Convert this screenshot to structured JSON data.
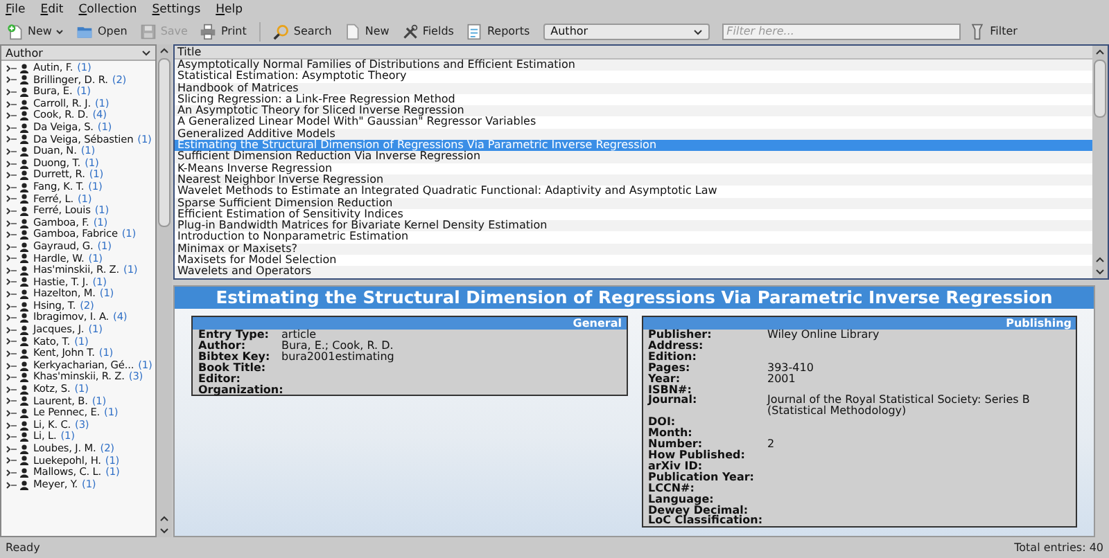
{
  "menu": [
    {
      "label": "File"
    },
    {
      "label": "Edit"
    },
    {
      "label": "Collection"
    },
    {
      "label": "Settings"
    },
    {
      "label": "Help"
    }
  ],
  "toolbar": {
    "buttons_left": [
      {
        "label": "New",
        "disabled": false,
        "has_menu": true
      },
      {
        "label": "Open",
        "disabled": false,
        "has_menu": false
      },
      {
        "label": "Save",
        "disabled": true,
        "has_menu": false
      },
      {
        "label": "Print",
        "disabled": false,
        "has_menu": false
      }
    ],
    "buttons_right": [
      {
        "label": "Search",
        "disabled": false,
        "has_menu": false
      },
      {
        "label": "New",
        "disabled": false,
        "has_menu": false
      },
      {
        "label": "Fields",
        "disabled": false,
        "has_menu": false
      },
      {
        "label": "Reports",
        "disabled": false,
        "has_menu": false
      }
    ],
    "field_selector": {
      "value": "Author"
    },
    "filter": {
      "placeholder": "Filter here..."
    },
    "filter_button": {
      "label": "Filter"
    }
  },
  "authors": {
    "header": "Author",
    "items": [
      {
        "name": "Autin, F.",
        "count": "(1)"
      },
      {
        "name": "Brillinger, D. R.",
        "count": "(2)"
      },
      {
        "name": "Bura, E.",
        "count": "(1)"
      },
      {
        "name": "Carroll, R. J.",
        "count": "(1)"
      },
      {
        "name": "Cook, R. D.",
        "count": "(4)"
      },
      {
        "name": "Da Veiga, S.",
        "count": "(1)"
      },
      {
        "name": "Da Veiga, Sébastien",
        "count": "(1)"
      },
      {
        "name": "Duan, N.",
        "count": "(1)"
      },
      {
        "name": "Duong, T.",
        "count": "(1)"
      },
      {
        "name": "Durrett, R.",
        "count": "(1)"
      },
      {
        "name": "Fang, K. T.",
        "count": "(1)"
      },
      {
        "name": "Ferré, L.",
        "count": "(1)"
      },
      {
        "name": "Ferré, Louis",
        "count": "(1)"
      },
      {
        "name": "Gamboa, F.",
        "count": "(1)"
      },
      {
        "name": "Gamboa, Fabrice",
        "count": "(1)"
      },
      {
        "name": "Gayraud, G.",
        "count": "(1)"
      },
      {
        "name": "Hardle, W.",
        "count": "(1)"
      },
      {
        "name": "Has'minskii, R. Z.",
        "count": "(1)"
      },
      {
        "name": "Hastie, T. J.",
        "count": "(1)"
      },
      {
        "name": "Hazelton, M.",
        "count": "(1)"
      },
      {
        "name": "Hsing, T.",
        "count": "(2)"
      },
      {
        "name": "Ibragimov, I. A.",
        "count": "(4)"
      },
      {
        "name": "Jacques, J.",
        "count": "(1)"
      },
      {
        "name": "Kato, T.",
        "count": "(1)"
      },
      {
        "name": "Kent, John T.",
        "count": "(1)"
      },
      {
        "name": "Kerkyacharian, Gé...",
        "count": "(1)"
      },
      {
        "name": "Khas'minskii, R. Z.",
        "count": "(3)"
      },
      {
        "name": "Kotz, S.",
        "count": "(1)"
      },
      {
        "name": "Laurent, B.",
        "count": "(1)"
      },
      {
        "name": "Le Pennec, E.",
        "count": "(1)"
      },
      {
        "name": "Li, K. C.",
        "count": "(3)"
      },
      {
        "name": "Li, L.",
        "count": "(1)"
      },
      {
        "name": "Loubes, J. M.",
        "count": "(2)"
      },
      {
        "name": "Luekepohl, H.",
        "count": "(1)"
      },
      {
        "name": "Mallows, C. L.",
        "count": "(1)"
      },
      {
        "name": "Meyer, Y.",
        "count": "(1)"
      }
    ]
  },
  "entries": {
    "header": "Title",
    "rows": [
      {
        "title": "Asymptotically Normal Families of Distributions and Efficient Estimation",
        "selected": false
      },
      {
        "title": "Statistical Estimation: Asymptotic Theory",
        "selected": false
      },
      {
        "title": "Handbook of Matrices",
        "selected": false
      },
      {
        "title": "Slicing Regression: a Link-Free Regression Method",
        "selected": false
      },
      {
        "title": "An Asymptotic Theory for Sliced Inverse Regression",
        "selected": false
      },
      {
        "title": "A Generalized Linear Model With\" Gaussian\" Regressor Variables",
        "selected": false
      },
      {
        "title": "Generalized Additive Models",
        "selected": false
      },
      {
        "title": "Estimating the Structural Dimension of Regressions Via Parametric Inverse Regression",
        "selected": true
      },
      {
        "title": "Sufficient Dimension Reduction Via Inverse Regression",
        "selected": false
      },
      {
        "title": "K-Means Inverse Regression",
        "selected": false
      },
      {
        "title": "Nearest Neighbor Inverse Regression",
        "selected": false
      },
      {
        "title": "Wavelet Methods to Estimate an Integrated Quadratic Functional: Adaptivity and Asymptotic Law",
        "selected": false
      },
      {
        "title": "Sparse Sufficient Dimension Reduction",
        "selected": false
      },
      {
        "title": "Efficient Estimation of Sensitivity Indices",
        "selected": false
      },
      {
        "title": "Plug-in Bandwidth Matrices for Bivariate Kernel Density Estimation",
        "selected": false
      },
      {
        "title": "Introduction to Nonparametric Estimation",
        "selected": false
      },
      {
        "title": "Minimax or Maxisets?",
        "selected": false
      },
      {
        "title": "Maxisets for Model Selection",
        "selected": false
      },
      {
        "title": "Wavelets and Operators",
        "selected": false
      }
    ]
  },
  "detail": {
    "title": "Estimating the Structural Dimension of Regressions Via Parametric Inverse Regression",
    "panels": [
      {
        "heading": "General",
        "fields": [
          {
            "label": "Entry Type:",
            "value": "article"
          },
          {
            "label": "Author:",
            "value": "Bura, E.; Cook, R. D."
          },
          {
            "label": "Bibtex Key:",
            "value": "bura2001estimating"
          },
          {
            "label": "Book Title:"
          },
          {
            "label": "Editor:"
          },
          {
            "label": "Organization:"
          }
        ]
      },
      {
        "heading": "Publishing",
        "fields": [
          {
            "label": "Publisher:",
            "value": "Wiley Online Library"
          },
          {
            "label": "Address:"
          },
          {
            "label": "Edition:"
          },
          {
            "label": "Pages:",
            "value": "393-410"
          },
          {
            "label": "Year:",
            "value": "2001"
          },
          {
            "label": "ISBN#:"
          },
          {
            "label": "Journal:",
            "value": "Journal of the Royal Statistical Society: Series B (Statistical Methodology)"
          },
          {
            "label": "DOI:"
          },
          {
            "label": "Month:"
          },
          {
            "label": "Number:",
            "value": "2"
          },
          {
            "label": "How Published:"
          },
          {
            "label": "arXiv ID:"
          },
          {
            "label": "Publication Year:"
          },
          {
            "label": "LCCN#:"
          },
          {
            "label": "Language:"
          },
          {
            "label": "Dewey Decimal:"
          },
          {
            "label": "LoC Classification:"
          }
        ]
      }
    ]
  },
  "status_bar": {
    "message": "Ready",
    "total": "Total entries: 40"
  }
}
